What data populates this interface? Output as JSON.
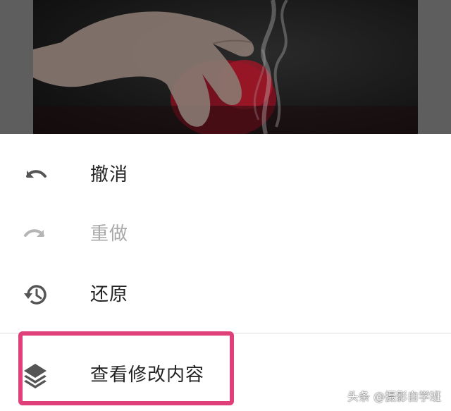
{
  "menu": {
    "items": [
      {
        "label": "撤消",
        "icon": "undo-icon",
        "enabled": true
      },
      {
        "label": "重做",
        "icon": "redo-icon",
        "enabled": false
      },
      {
        "label": "还原",
        "icon": "history-restore-icon",
        "enabled": true
      },
      {
        "label": "查看修改内容",
        "icon": "layers-icon",
        "enabled": true
      }
    ]
  },
  "watermark": "头条 @摄影自学班",
  "colors": {
    "highlight": "#e0407a",
    "text": "#222222",
    "disabled_text": "#a8a8a8",
    "icon": "#555555",
    "disabled_icon": "#b5b5b5"
  }
}
